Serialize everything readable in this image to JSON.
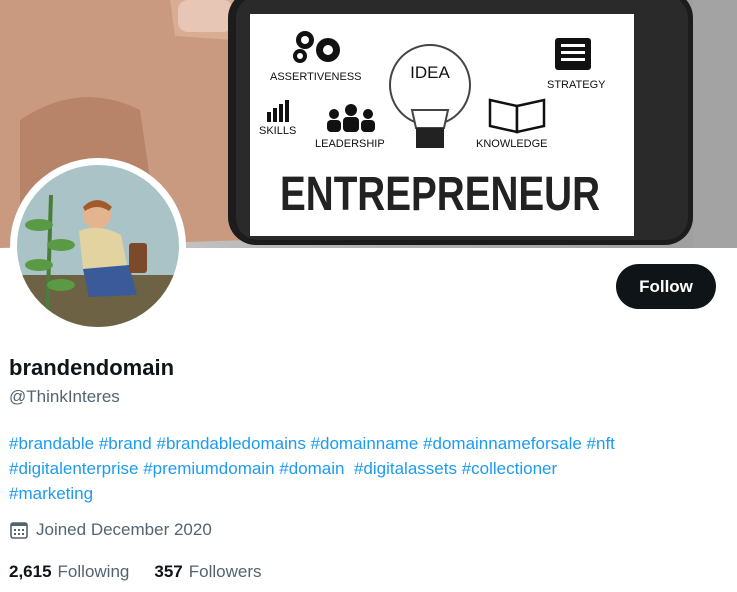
{
  "banner": {
    "labels": {
      "assertiveness": "ASSERTIVENESS",
      "idea": "IDEA",
      "strategy": "STRATEGY",
      "skills": "SKILLS",
      "leadership": "LEADERSHIP",
      "knowledge": "KNOWLEDGE",
      "headline": "ENTREPRENEUR"
    }
  },
  "profile": {
    "name": "brandendomain",
    "handle": "@ThinkInteres",
    "follow_label": "Follow",
    "bio_lines": [
      [
        "#brandable",
        "#brand",
        "#brandabledomains",
        "#domainname",
        "#domainnameforsale",
        "#nft"
      ],
      [
        "#digitalenterprise",
        "#premiumdomain",
        "#domain",
        "#digitalassets",
        "#collectioner"
      ],
      [
        "#marketing"
      ]
    ],
    "joined": "Joined December 2020",
    "following_count": "2,615",
    "following_label": "Following",
    "followers_count": "357",
    "followers_label": "Followers"
  },
  "colors": {
    "link": "#1d9bf0",
    "button_bg": "#0f1419",
    "secondary_text": "#536471"
  }
}
